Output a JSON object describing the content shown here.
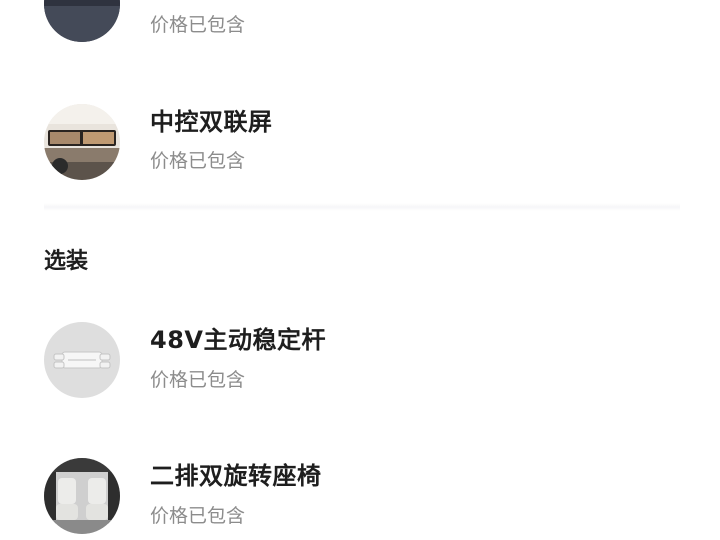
{
  "included_items": [
    {
      "title": "",
      "subtitle": "价格已包含"
    },
    {
      "title": "中控双联屏",
      "subtitle": "价格已包含"
    }
  ],
  "optional_section": {
    "title": "选装",
    "items": [
      {
        "title": "48V主动稳定杆",
        "subtitle": "价格已包含"
      },
      {
        "title": "二排双旋转座椅",
        "subtitle": "价格已包含"
      }
    ]
  },
  "icons": {
    "item1": "dark-car-detail-thumbnail",
    "item2": "dual-screen-dashboard-thumbnail",
    "item3": "stabilizer-bar-thumbnail",
    "item4": "rotating-seats-thumbnail"
  },
  "colors": {
    "title_text": "#1e1e1e",
    "subtitle_text": "#8c8c8c",
    "divider": "#f6f6f8"
  }
}
